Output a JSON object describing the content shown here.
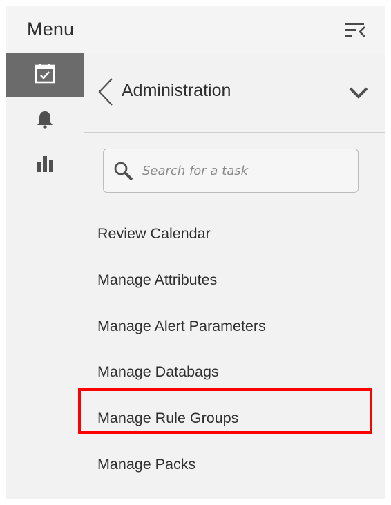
{
  "header": {
    "title": "Menu",
    "collapse_icon": "collapse-menu-icon"
  },
  "rail": {
    "items": [
      {
        "icon": "calendar-check-icon",
        "active": true
      },
      {
        "icon": "bell-icon",
        "active": false
      },
      {
        "icon": "bar-chart-icon",
        "active": false
      }
    ],
    "active_color": "#6b6b6b"
  },
  "section": {
    "title": "Administration",
    "back_icon": "chevron-left-icon",
    "expand_icon": "chevron-down-icon"
  },
  "search": {
    "placeholder": "Search for a task",
    "value": "",
    "icon": "search-icon"
  },
  "tasks": [
    {
      "label": "Review Calendar",
      "highlighted": false
    },
    {
      "label": "Manage Attributes",
      "highlighted": false
    },
    {
      "label": "Manage Alert Parameters",
      "highlighted": false
    },
    {
      "label": "Manage Databags",
      "highlighted": false
    },
    {
      "label": "Manage Rule Groups",
      "highlighted": true
    },
    {
      "label": "Manage Packs",
      "highlighted": false
    }
  ],
  "colors": {
    "panel_background": "#f2f2f2",
    "highlight": "#ff0000",
    "text": "#2f2f2f"
  }
}
